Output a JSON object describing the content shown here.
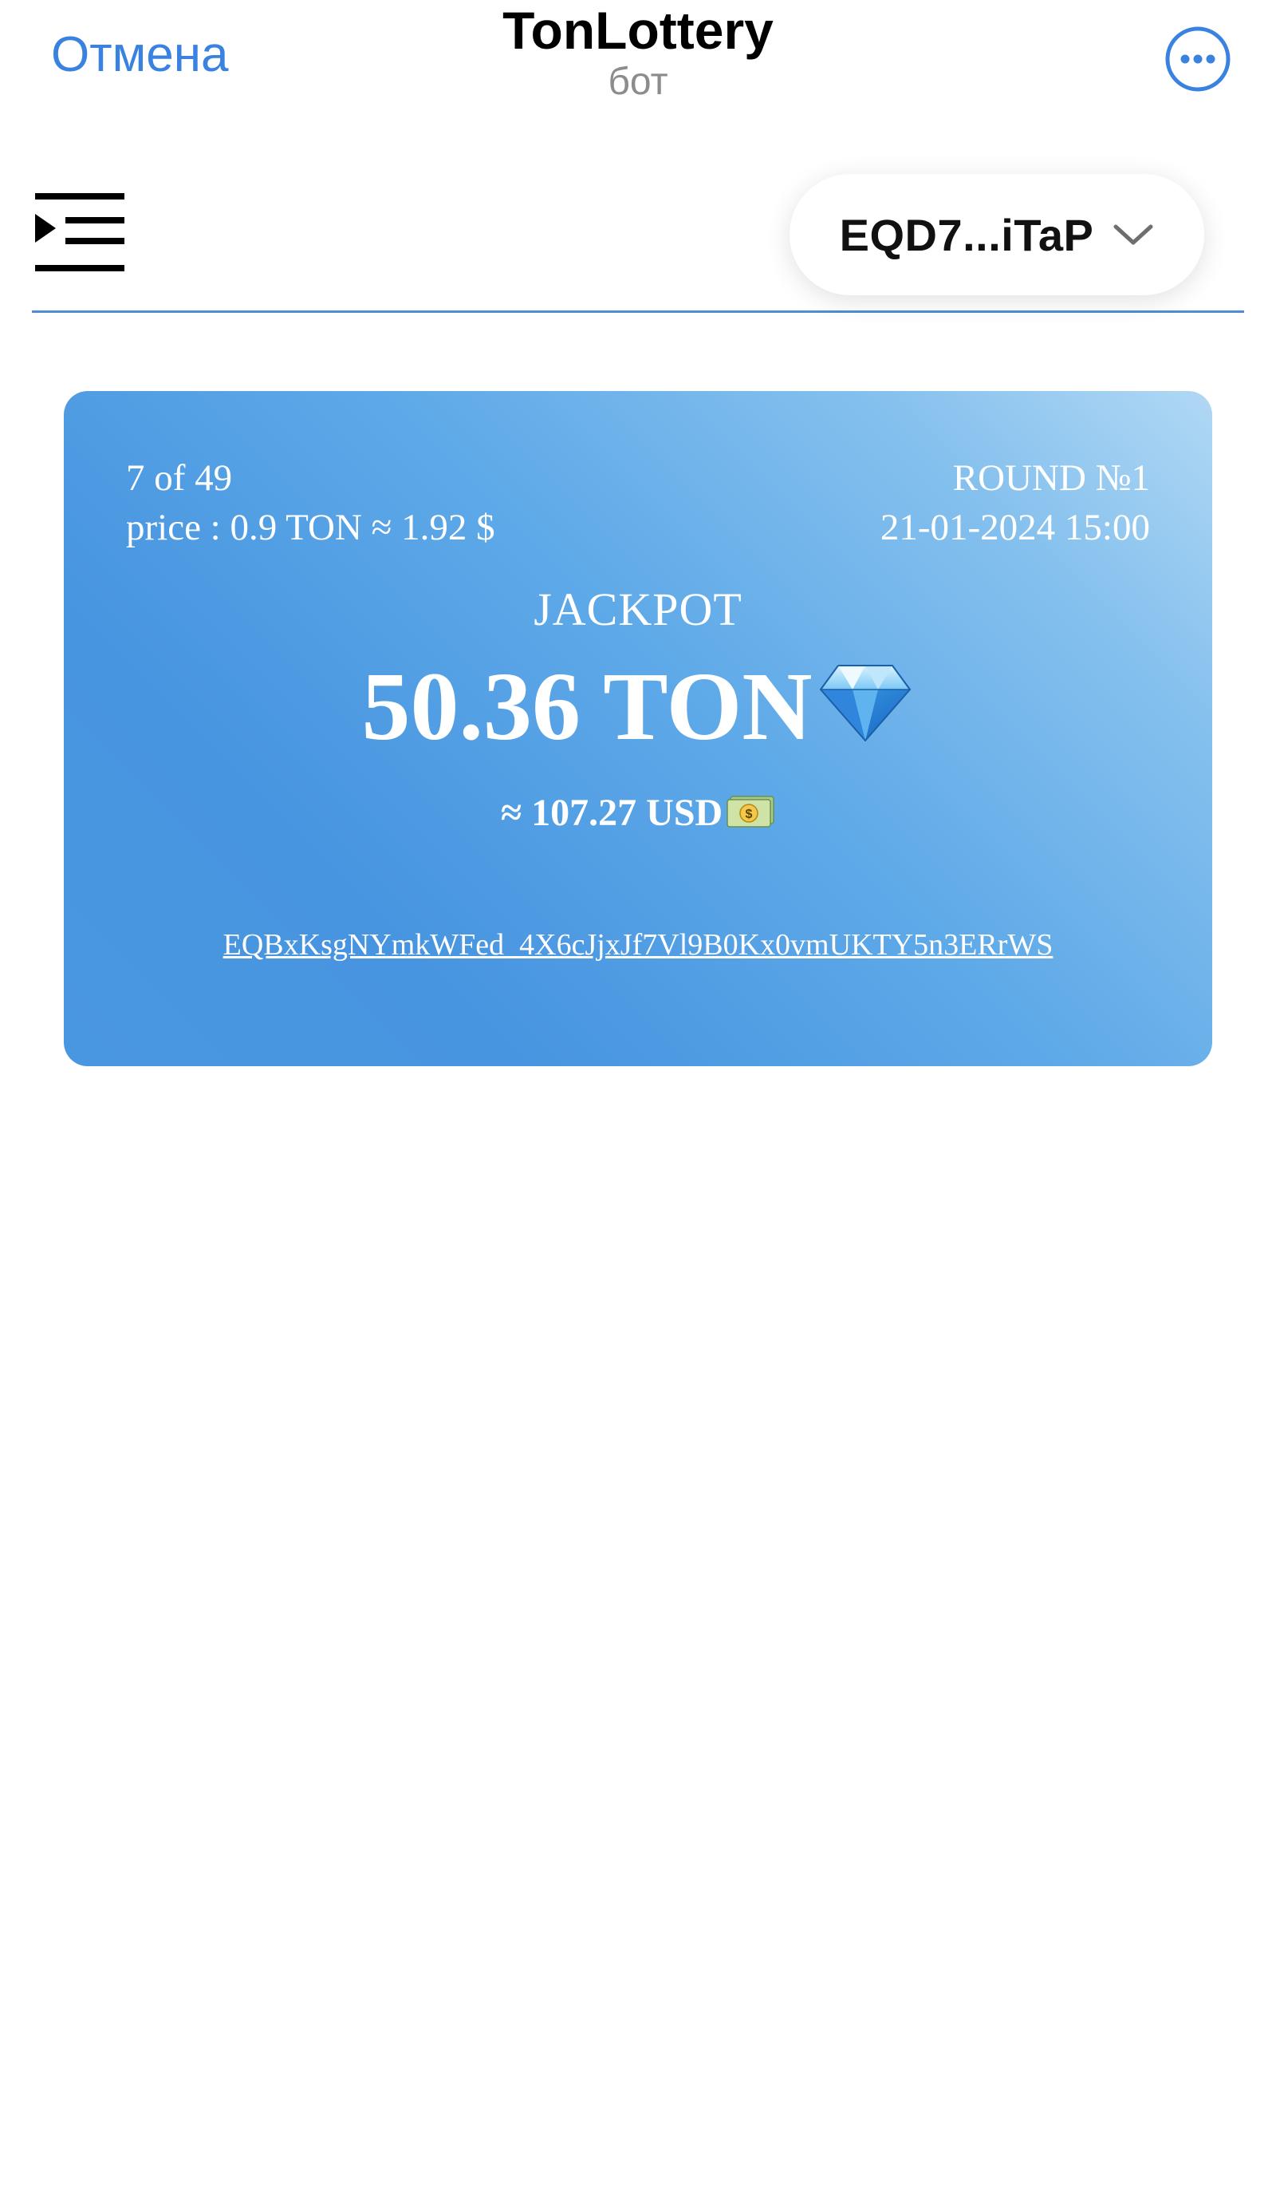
{
  "topbar": {
    "cancel_label": "Отмена",
    "title": "TonLottery",
    "subtitle": "бот",
    "more_icon": "ellipsis-circle-icon",
    "accent_color": "#3a82e0"
  },
  "header": {
    "menu_icon": "menu-indent-icon",
    "wallet_address": "EQD7...iTaP",
    "dropdown_icon": "chevron-down-icon",
    "divider_color": "#4f8cd6"
  },
  "card": {
    "progress_text": "7 of 49",
    "price_text": "price : 0.9 TON ≈ 1.92 $",
    "round_text": "ROUND №1",
    "datetime_text": "21-01-2024 15:00",
    "jackpot_label": "JACKPOT",
    "jackpot_amount": "50.36 TON",
    "jackpot_icon": "gem-icon",
    "usd_amount": "≈ 107.27 USD",
    "usd_icon": "dollar-banknote-icon",
    "contract_address": "EQBxKsgNYmkWFed_4X6cJjxJf7Vl9B0Kx0vmUKTY5n3ERrWS",
    "gradient_colors": [
      "#b1d8f4",
      "#4794e0"
    ]
  }
}
